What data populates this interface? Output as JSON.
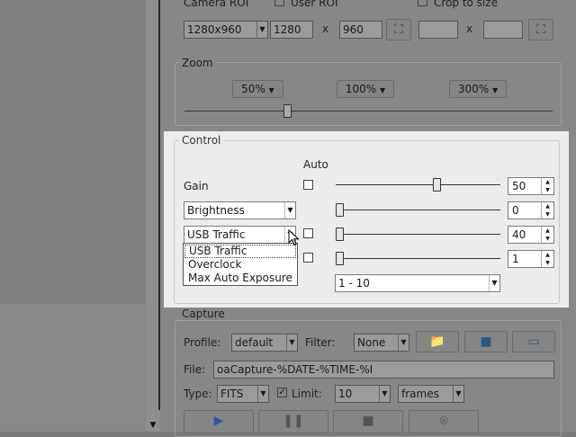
{
  "camera_roi": {
    "label": "Camera ROI",
    "user_roi_label": "User ROI",
    "crop_label": "Crop to size",
    "resolution": "1280x960",
    "width": "1280",
    "x_sep": "x",
    "height": "960",
    "x_sep2": "x"
  },
  "zoom": {
    "title": "Zoom",
    "options": [
      "50%",
      "100%",
      "300%"
    ]
  },
  "control": {
    "title": "Control",
    "auto_label": "Auto",
    "gain_label": "Gain",
    "gain_value": "50",
    "gain_fraction": 0.61,
    "brightness_combo": "Brightness",
    "brightness_value": "0",
    "usb_combo": "USB Traffic",
    "usb_value": "40",
    "fourth_value": "1",
    "range_combo": "1 - 10",
    "dropdown_options": [
      "USB Traffic",
      "Overclock",
      "Max Auto Exposure"
    ]
  },
  "capture": {
    "title": "Capture",
    "profile_label": "Profile:",
    "profile_value": "default",
    "filter_label": "Filter:",
    "filter_value": "None",
    "file_label": "File:",
    "file_value": "oaCapture-%DATE-%TIME-%I",
    "type_label": "Type:",
    "type_value": "FITS",
    "limit_label": "Limit:",
    "limit_value": "10",
    "limit_unit": "frames"
  }
}
